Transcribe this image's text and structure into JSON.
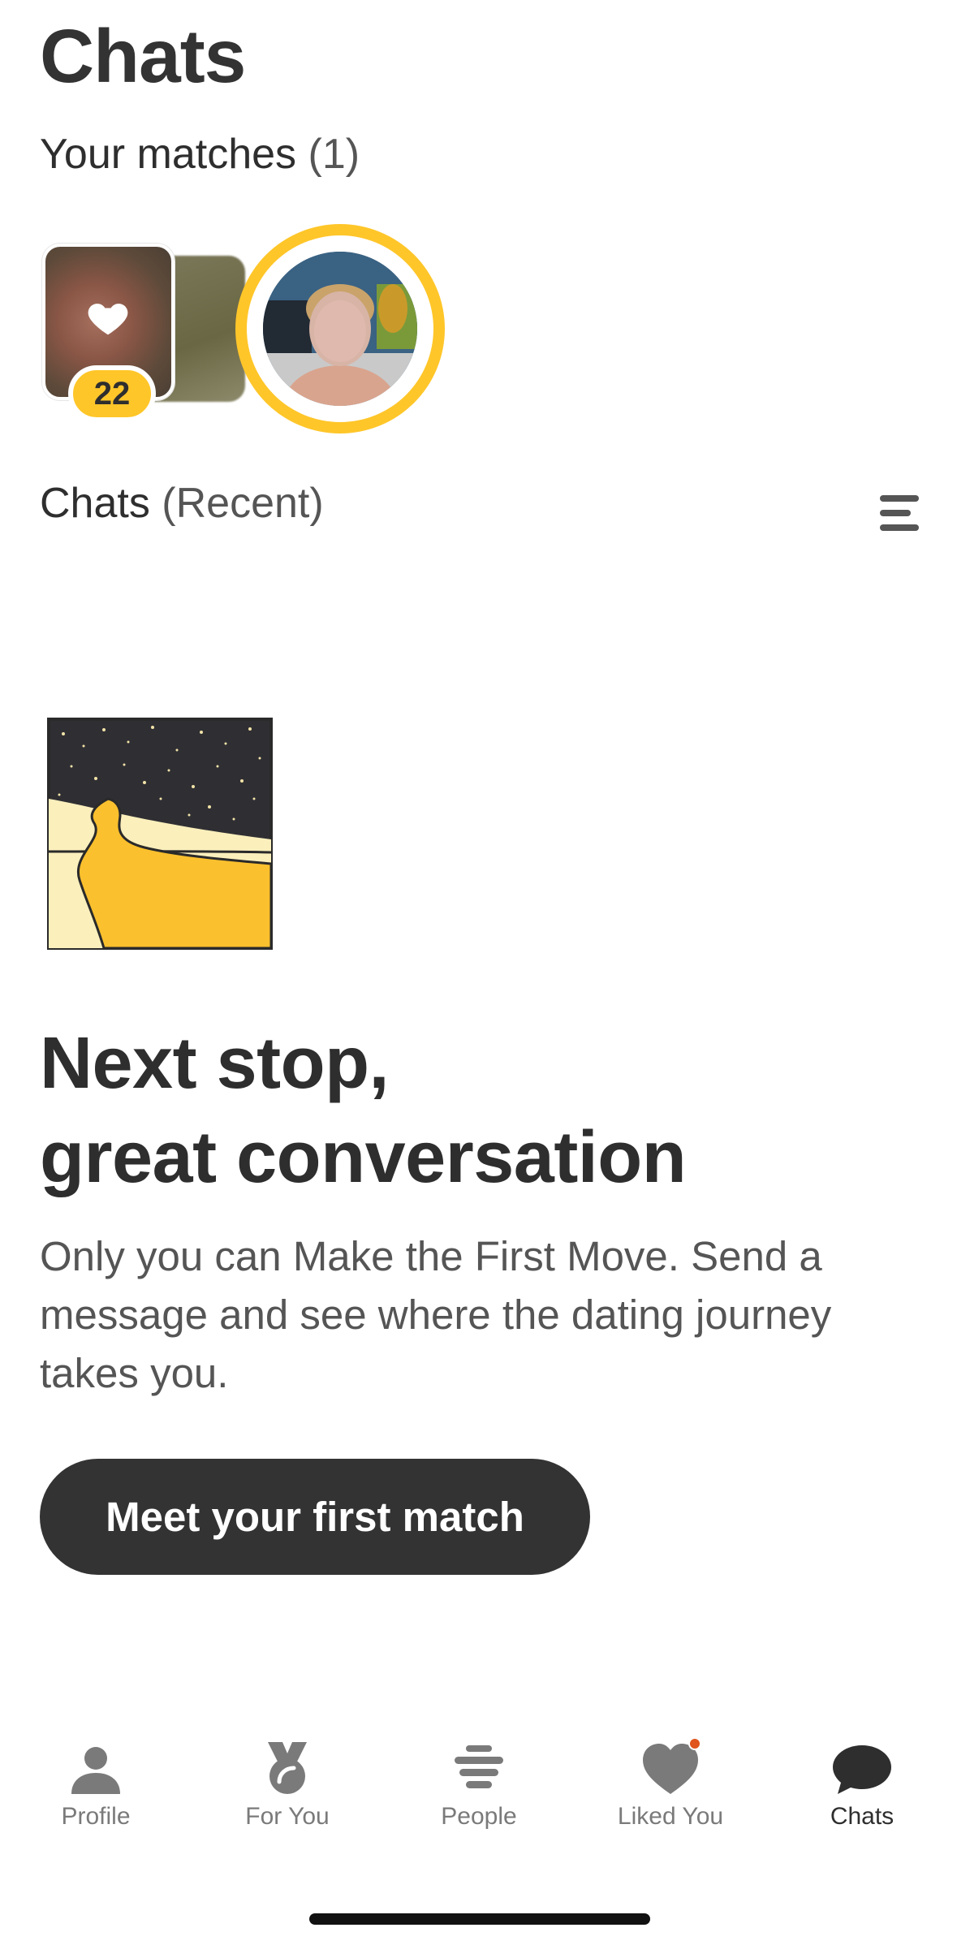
{
  "header": {
    "title": "Chats"
  },
  "matches": {
    "label": "Your matches",
    "count": "(1)",
    "likes_count": "22"
  },
  "chats": {
    "label": "Chats",
    "filter": "(Recent)"
  },
  "empty_state": {
    "headline_line1": "Next stop,",
    "headline_line2": "great conversation",
    "body": "Only you can Make the First Move. Send a message and see where the dating journey takes you.",
    "cta_label": "Meet your first match"
  },
  "bottom_nav": {
    "items": [
      {
        "label": "Profile",
        "icon": "person-icon"
      },
      {
        "label": "For You",
        "icon": "medal-icon"
      },
      {
        "label": "People",
        "icon": "stack-icon"
      },
      {
        "label": "Liked You",
        "icon": "heart-icon"
      },
      {
        "label": "Chats",
        "icon": "chat-bubble-icon"
      }
    ],
    "active": "Chats"
  },
  "colors": {
    "brand_yellow": "#ffc629",
    "text_dark": "#2e2e2e",
    "text_muted": "#555555",
    "button_bg": "#333333",
    "notification_dot": "#e0541e"
  }
}
